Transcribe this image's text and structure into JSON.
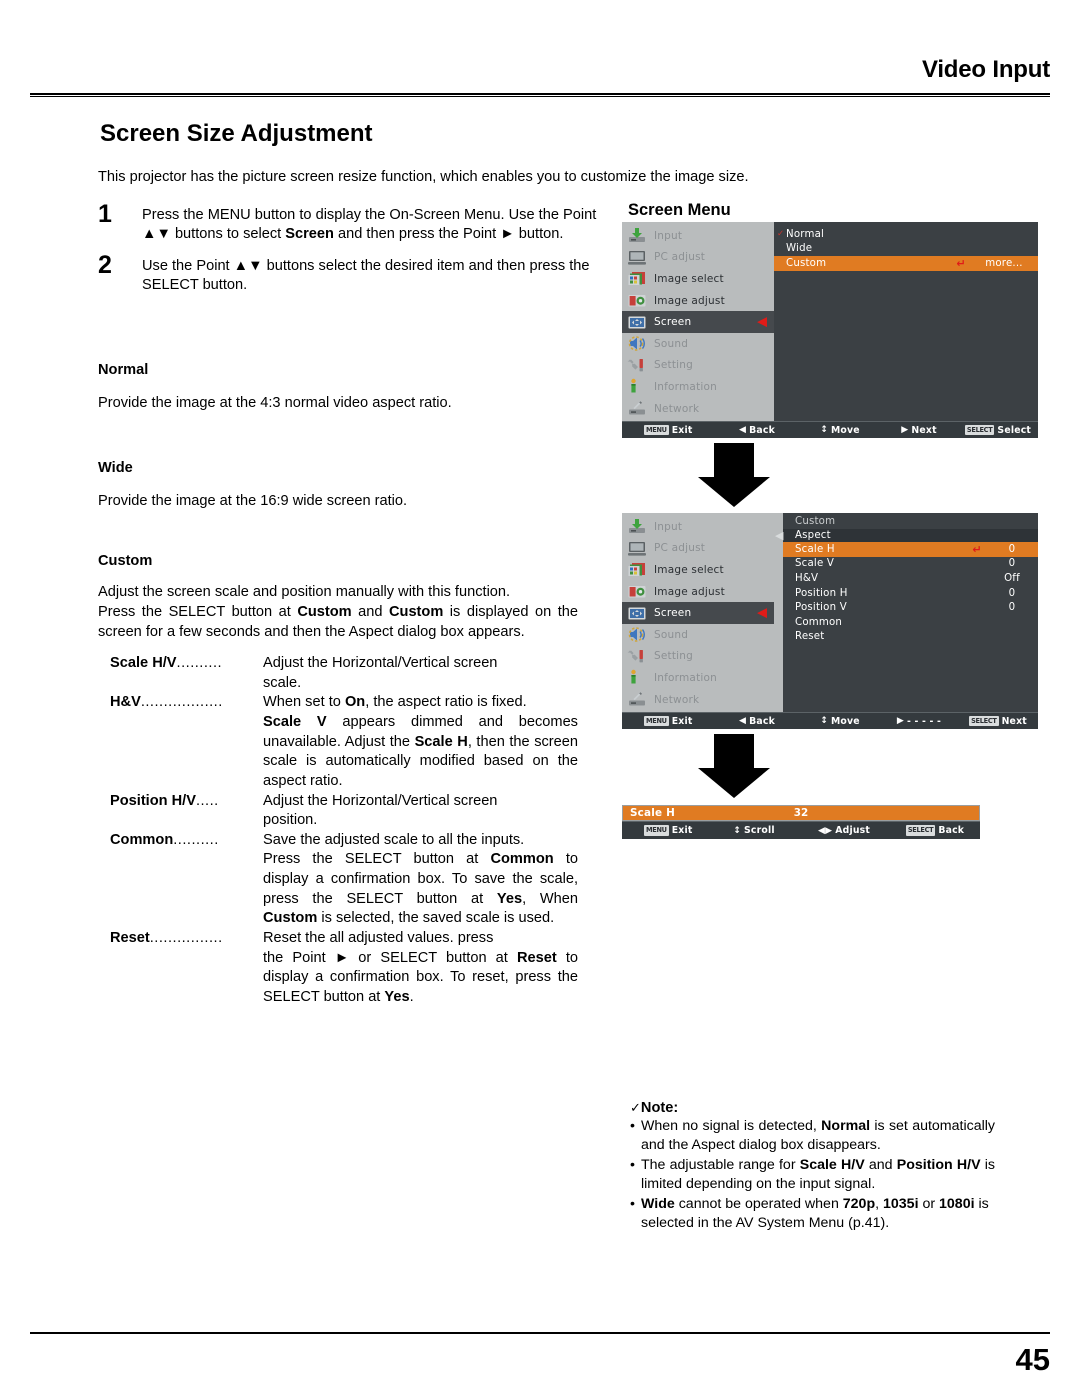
{
  "header": {
    "title": "Video Input"
  },
  "page": {
    "number": "45"
  },
  "title": "Screen Size Adjustment",
  "intro": "This projector has the picture screen resize function, which enables you to customize the image size.",
  "steps": [
    {
      "num": "1",
      "html": "Press the MENU button to display the On-Screen Menu. Use the Point ▲▼ buttons to select <b>Screen</b> and then press the Point ► button."
    },
    {
      "num": "2",
      "html": "Use the Point ▲▼ buttons select the desired item and then press the SELECT button."
    }
  ],
  "sections": {
    "normal": {
      "heading": "Normal",
      "body": "Provide the image at the 4:3 normal video aspect ratio."
    },
    "wide": {
      "heading": "Wide",
      "body": "Provide the image at the 16:9 wide screen ratio."
    },
    "custom": {
      "heading": "Custom",
      "body1": "Adjust the screen scale and position manually with this function.",
      "body2_html": "Press the SELECT button at <b>Custom</b> and <b>Custom</b> is displayed on the screen for a few seconds and then the Aspect dialog box appears."
    }
  },
  "definitions": [
    {
      "term": "Scale H/V",
      "leader": "..........",
      "desc_html": "Adjust the Horizontal/Vertical screen",
      "cont_html": "scale."
    },
    {
      "term": "H&V",
      "leader": "..................",
      "desc_html": "When set to <b>On</b>, the aspect ratio is fixed.",
      "cont_html": "<b>Scale V</b> appears dimmed and becomes unavailable. Adjust the <b>Scale H</b>, then the screen scale is automatically modified based on the aspect ratio."
    },
    {
      "term": "Position H/V",
      "leader": ".....",
      "desc_html": "Adjust the Horizontal/Vertical screen",
      "cont_html": "position."
    },
    {
      "term": "Common",
      "leader": "..........",
      "desc_html": "Save the adjusted scale to all the inputs.",
      "cont_html": "Press the SELECT button at <b>Common</b> to display a confirmation box. To save the scale, press the SELECT button at <b>Yes</b>, When <b>Custom</b> is selected, the saved scale is used."
    },
    {
      "term": "Reset",
      "leader": "................",
      "desc_html": "Reset the all adjusted values. press",
      "cont_html": "the Point ► or SELECT button at <b>Reset</b> to display a confirmation box. To reset, press the SELECT button at <b>Yes</b>."
    }
  ],
  "screen_menu_label": "Screen Menu",
  "osd": {
    "sidebar_items": [
      {
        "label": "Input",
        "icon": "input-icon",
        "state": "normal"
      },
      {
        "label": "PC adjust",
        "icon": "pc-adjust-icon",
        "state": "normal"
      },
      {
        "label": "Image select",
        "icon": "image-select-icon",
        "state": "bright"
      },
      {
        "label": "Image adjust",
        "icon": "image-adjust-icon",
        "state": "bright"
      },
      {
        "label": "Screen",
        "icon": "screen-icon",
        "state": "active",
        "caret": "◀"
      },
      {
        "label": "Sound",
        "icon": "sound-icon",
        "state": "normal"
      },
      {
        "label": "Setting",
        "icon": "setting-icon",
        "state": "normal"
      },
      {
        "label": "Information",
        "icon": "information-icon",
        "state": "normal"
      },
      {
        "label": "Network",
        "icon": "network-icon",
        "state": "normal"
      }
    ],
    "menu1": {
      "options": [
        {
          "name": "Normal",
          "checked": true,
          "selected": false,
          "value": "",
          "enter": ""
        },
        {
          "name": "Wide",
          "checked": false,
          "selected": false,
          "value": "",
          "enter": ""
        },
        {
          "name": "Custom",
          "checked": false,
          "selected": true,
          "value": "more...",
          "enter": "↵"
        }
      ],
      "bottom_bar": [
        {
          "key": "MENU",
          "label": "Exit",
          "glyph": ""
        },
        {
          "key": "",
          "label": "Back",
          "glyph": "◀"
        },
        {
          "key": "",
          "label": "Move",
          "glyph": "↕"
        },
        {
          "key": "",
          "label": "Next",
          "glyph": "▶"
        },
        {
          "key": "SELECT",
          "label": "Select",
          "glyph": ""
        }
      ]
    },
    "menu2": {
      "panel_title": "Custom",
      "group_title": "Aspect",
      "rows": [
        {
          "name": "Scale H",
          "value": "0",
          "selected": true,
          "enter": "↵"
        },
        {
          "name": "Scale V",
          "value": "0",
          "selected": false,
          "enter": ""
        },
        {
          "name": "H&V",
          "value": "Off",
          "selected": false,
          "enter": ""
        },
        {
          "name": "Position H",
          "value": "0",
          "selected": false,
          "enter": ""
        },
        {
          "name": "Position V",
          "value": "0",
          "selected": false,
          "enter": ""
        },
        {
          "name": "Common",
          "value": "",
          "selected": false,
          "enter": ""
        },
        {
          "name": "Reset",
          "value": "",
          "selected": false,
          "enter": ""
        }
      ],
      "bottom_bar": [
        {
          "key": "MENU",
          "label": "Exit",
          "glyph": ""
        },
        {
          "key": "",
          "label": "Back",
          "glyph": "◀"
        },
        {
          "key": "",
          "label": "Move",
          "glyph": "↕"
        },
        {
          "key": "",
          "label": "- - - - -",
          "glyph": "▶"
        },
        {
          "key": "SELECT",
          "label": "Next",
          "glyph": ""
        }
      ]
    },
    "menu3": {
      "label": "Scale H",
      "value": "32",
      "bottom_bar": [
        {
          "key": "MENU",
          "label": "Exit",
          "glyph": ""
        },
        {
          "key": "",
          "label": "Scroll",
          "glyph": "↕"
        },
        {
          "key": "",
          "label": "Adjust",
          "glyph": "◀▶"
        },
        {
          "key": "SELECT",
          "label": "Back",
          "glyph": ""
        }
      ]
    }
  },
  "note": {
    "title": "Note:",
    "check": "✓",
    "items": [
      {
        "html": "When no signal is detected, <b>Normal</b> is set automatically and the Aspect dialog box disappears."
      },
      {
        "html": "The adjustable range for <b>Scale H/V</b> and <b>Position H/V</b> is limited depending on the input signal."
      },
      {
        "html": "<b>Wide</b> cannot be operated when <b>720p</b>, <b>1035i</b> or <b>1080i</b> is selected in the AV System Menu (p.41)."
      }
    ]
  },
  "colors": {
    "osd_highlight": "#e07b22",
    "osd_sidebar": "#b9bcbd",
    "osd_panel": "#3b4044",
    "osd_bar": "#343a3e",
    "red_caret": "#e01b18"
  }
}
